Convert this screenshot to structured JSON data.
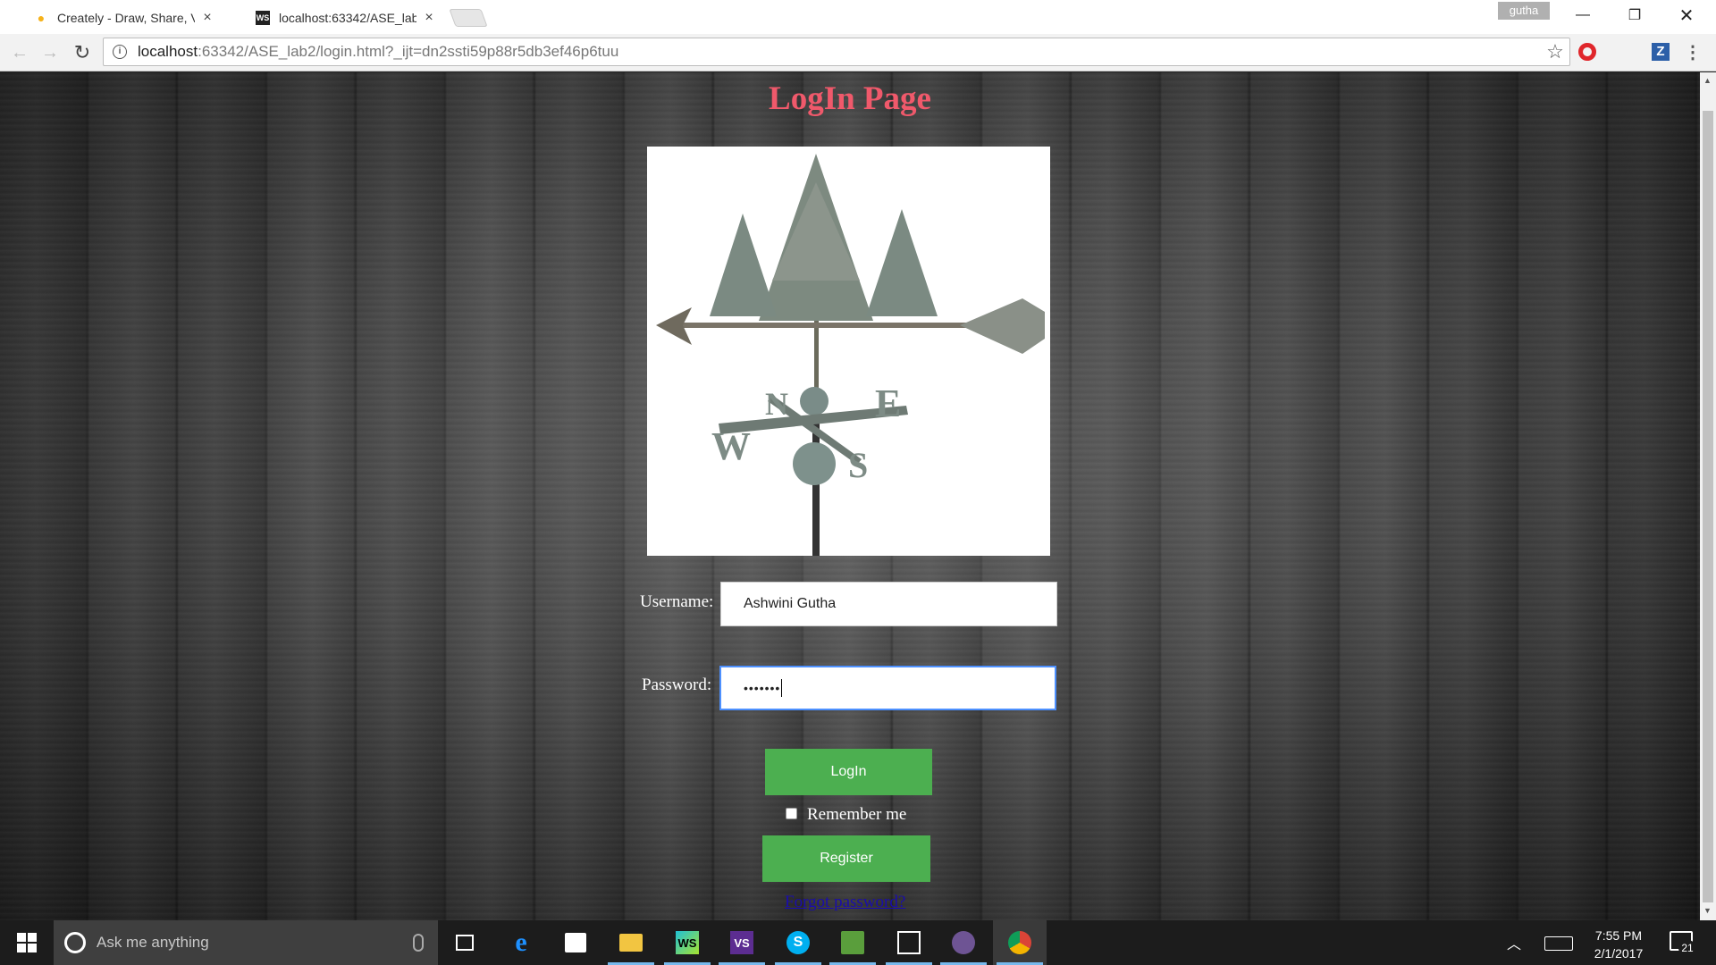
{
  "browser": {
    "tabs": [
      {
        "title": "Creately - Draw, Share, V",
        "icon": "bulb-icon"
      },
      {
        "title": "localhost:63342/ASE_lab",
        "icon": "webstorm-icon"
      }
    ],
    "profile_name": "gutha",
    "url_host": "localhost",
    "url_rest": ":63342/ASE_lab2/login.html?_ijt=dn2ssti59p88r5db3ef46p6tuu"
  },
  "page": {
    "title": "LogIn Page",
    "image": {
      "compass_letters": [
        "N",
        "E",
        "W",
        "S"
      ]
    },
    "username_label": "Username:",
    "username_value": "Ashwini Gutha",
    "password_label": "Password:",
    "password_masked": "•••••••",
    "login_label": "LogIn",
    "remember_label": "Remember me",
    "register_label": "Register",
    "forgot_label": "Forgot password?",
    "colors": {
      "title": "#f0596b",
      "button": "#4caf50",
      "link": "#1a0dab"
    }
  },
  "taskbar": {
    "search_placeholder": "Ask me anything",
    "apps": [
      {
        "name": "task-view",
        "glyph": ""
      },
      {
        "name": "edge",
        "glyph": "e"
      },
      {
        "name": "store",
        "glyph": ""
      },
      {
        "name": "file-explorer",
        "glyph": ""
      },
      {
        "name": "webstorm",
        "glyph": "WS"
      },
      {
        "name": "visual-studio",
        "glyph": "VS"
      },
      {
        "name": "skype",
        "glyph": "S"
      },
      {
        "name": "app-green",
        "glyph": ""
      },
      {
        "name": "photos",
        "glyph": ""
      },
      {
        "name": "github",
        "glyph": ""
      },
      {
        "name": "chrome",
        "glyph": ""
      }
    ],
    "time": "7:55 PM",
    "date": "2/1/2017",
    "notification_count": "21"
  }
}
